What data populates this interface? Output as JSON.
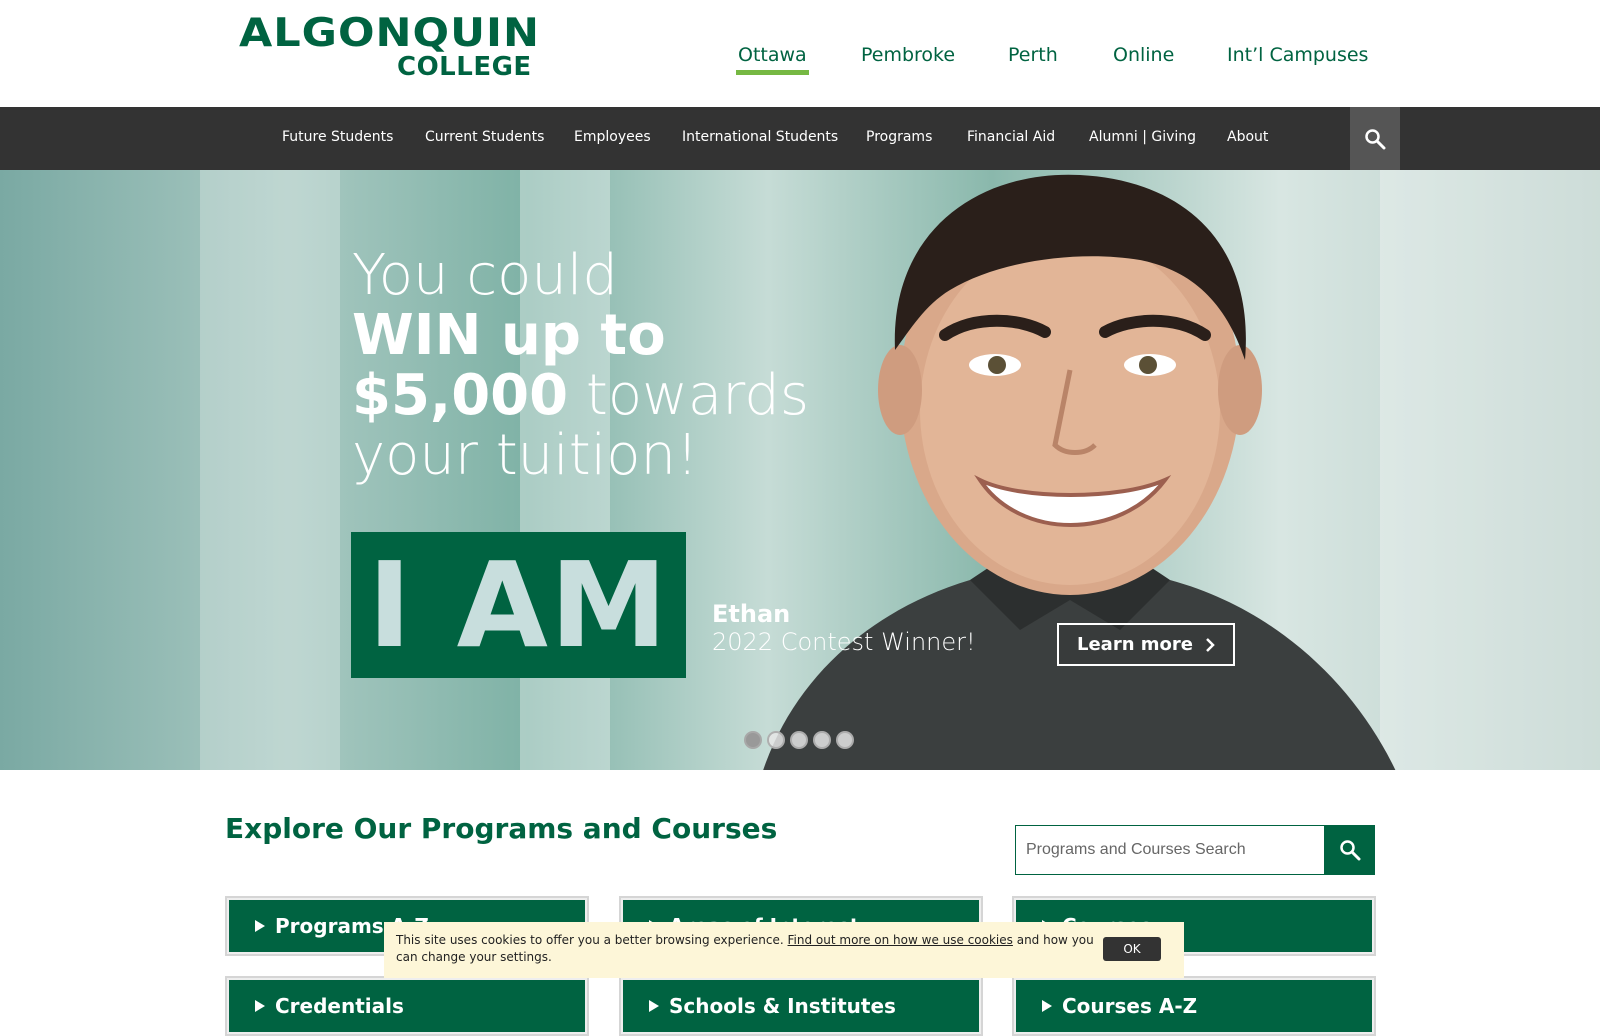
{
  "logo": {
    "line1": "ALGONQUIN",
    "line2": "COLLEGE"
  },
  "campus_nav": [
    {
      "label": "Ottawa",
      "active": true
    },
    {
      "label": "Pembroke",
      "active": false
    },
    {
      "label": "Perth",
      "active": false
    },
    {
      "label": "Online",
      "active": false
    },
    {
      "label": "Int’l Campuses",
      "active": false
    }
  ],
  "main_nav": [
    {
      "label": "Future Students"
    },
    {
      "label": "Current Students"
    },
    {
      "label": "Employees"
    },
    {
      "label": "International Students"
    },
    {
      "label": "Programs"
    },
    {
      "label": "Financial Aid"
    },
    {
      "label": "Alumni | Giving"
    },
    {
      "label": "About"
    }
  ],
  "hero": {
    "line1": "You could",
    "line2": "WIN up to",
    "line3_bold": "$5,000",
    "line3_rest": " towards",
    "line4": "your tuition!",
    "iam": "I AM",
    "winner_name": "Ethan",
    "winner_sub": "2022 Contest Winner!",
    "cta": "Learn more",
    "slides_total": 5,
    "slide_active": 1
  },
  "programs": {
    "title": "Explore Our Programs and Courses",
    "search_placeholder": "Programs and Courses Search",
    "cards_row1": [
      "Programs A-Z",
      "Areas of Interest",
      "Courses"
    ],
    "cards_row2": [
      "Credentials",
      "Schools & Institutes",
      "Courses A-Z"
    ]
  },
  "cookie": {
    "text_before": "This site uses cookies to offer you a better browsing experience. ",
    "link": "Find out more on how we use cookies",
    "text_after": " and how you can change your settings.",
    "ok": "OK"
  },
  "colors": {
    "brand_green": "#006341",
    "accent_green": "#76b843",
    "nav_bg": "#333333",
    "cookie_bg": "#fdf6d8"
  }
}
